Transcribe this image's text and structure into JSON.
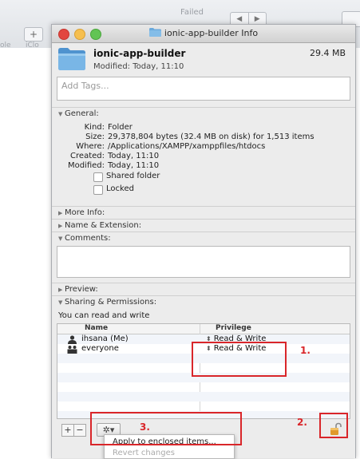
{
  "background": {
    "status": "Failed",
    "nav_back": "◀",
    "nav_forward": "▶",
    "plus": "+",
    "sidebar_1": "ole",
    "sidebar_2": "iClo"
  },
  "window": {
    "title": "ionic-app-builder Info",
    "folder_name": "ionic-app-builder",
    "size": "29.4 MB",
    "modified_header": "Modified: Today, 11:10",
    "tags_placeholder": "Add Tags..."
  },
  "general": {
    "heading": "General:",
    "kind_label": "Kind:",
    "kind": "Folder",
    "size_label": "Size:",
    "size": "29,378,804 bytes (32.4 MB on disk) for 1,513 items",
    "where_label": "Where:",
    "where": "/Applications/XAMPP/xamppfiles/htdocs",
    "created_label": "Created:",
    "created": "Today, 11:10",
    "modified_label": "Modified:",
    "modified": "Today, 11:10",
    "shared_folder": "Shared folder",
    "locked": "Locked"
  },
  "sections": {
    "more_info": "More Info:",
    "name_extension": "Name & Extension:",
    "comments": "Comments:",
    "preview": "Preview:",
    "sharing": "Sharing & Permissions:"
  },
  "permissions": {
    "summary": "You can read and write",
    "col_name": "Name",
    "col_privilege": "Privilege",
    "rows": [
      {
        "name": "ihsana (Me)",
        "privilege": "Read & Write",
        "icon": "user-icon"
      },
      {
        "name": "everyone",
        "privilege": "Read & Write",
        "icon": "group-icon"
      }
    ],
    "stepper": "⬍"
  },
  "toolbar": {
    "add": "+",
    "remove": "−",
    "gear": "✲▾"
  },
  "menu": {
    "apply": "Apply to enclosed items...",
    "revert": "Revert changes"
  },
  "annotations": {
    "label_1": "1.",
    "label_2": "2.",
    "label_3": "3."
  },
  "colors": {
    "annotation_red": "#d9262a",
    "folder_blue": "#5a9fd6",
    "lock_orange": "#e09a2c"
  }
}
